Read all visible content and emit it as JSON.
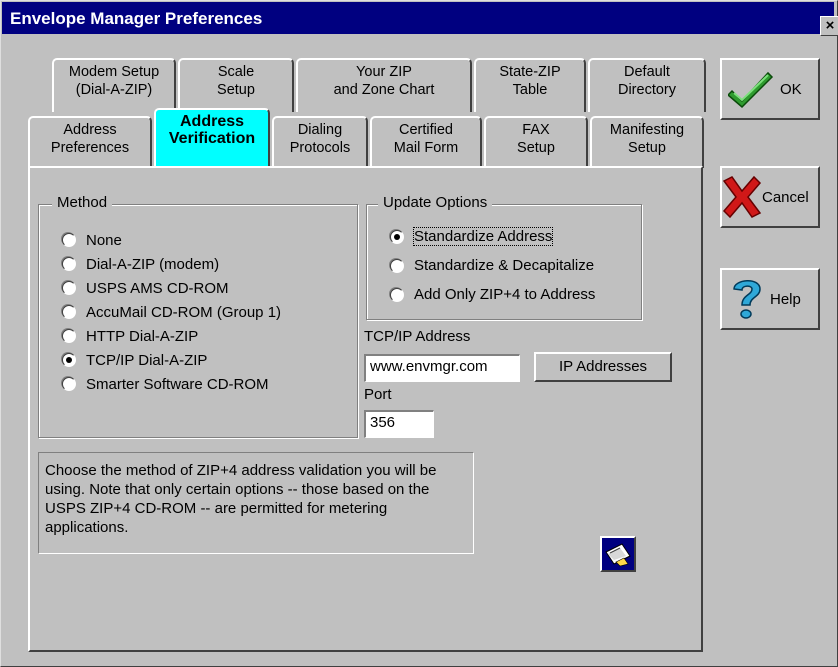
{
  "window": {
    "title": "Envelope Manager Preferences",
    "close_label": "×"
  },
  "tabs_back": [
    {
      "label": "Modem Setup\n(Dial-A-ZIP)"
    },
    {
      "label": "Scale\nSetup"
    },
    {
      "label": "Your ZIP\nand Zone Chart"
    },
    {
      "label": "State-ZIP\nTable"
    },
    {
      "label": "Default\nDirectory"
    }
  ],
  "tabs_front": [
    {
      "label": "Address\nPreferences"
    },
    {
      "label": "Address\nVerification"
    },
    {
      "label": "Dialing\nProtocols"
    },
    {
      "label": "Certified\nMail Form"
    },
    {
      "label": "FAX\nSetup"
    },
    {
      "label": "Manifesting\nSetup"
    }
  ],
  "method": {
    "legend": "Method",
    "options": [
      {
        "label": "None",
        "selected": false
      },
      {
        "label": "Dial-A-ZIP (modem)",
        "selected": false
      },
      {
        "label": "USPS AMS CD-ROM",
        "selected": false
      },
      {
        "label": "AccuMail CD-ROM (Group 1)",
        "selected": false
      },
      {
        "label": "HTTP Dial-A-ZIP",
        "selected": false
      },
      {
        "label": "TCP/IP Dial-A-ZIP",
        "selected": true
      },
      {
        "label": "Smarter Software CD-ROM",
        "selected": false
      }
    ]
  },
  "update": {
    "legend": "Update Options",
    "options": [
      {
        "label": "Standardize Address",
        "selected": true
      },
      {
        "label": "Standardize & Decapitalize",
        "selected": false
      },
      {
        "label": "Add Only ZIP+4 to Address",
        "selected": false
      }
    ]
  },
  "tcpip": {
    "label": "TCP/IP Address",
    "value": "www.envmgr.com",
    "ip_button": "IP Addresses"
  },
  "port": {
    "label": "Port",
    "value": "356"
  },
  "note": "Choose the method of ZIP+4 address validation you will be using.  Note that only certain options -- those based on the USPS ZIP+4 CD-ROM -- are permitted for metering applications.",
  "buttons": {
    "ok": "OK",
    "cancel": "Cancel",
    "help": "Help"
  }
}
